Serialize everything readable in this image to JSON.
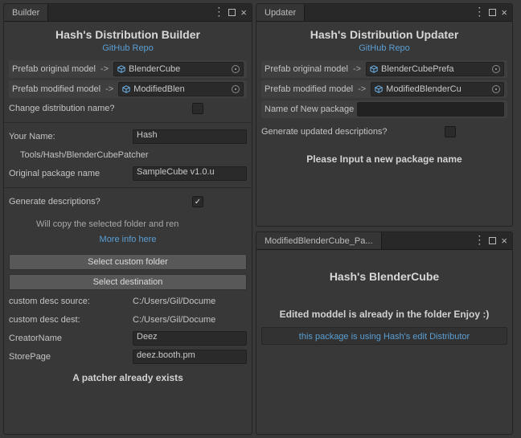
{
  "builder": {
    "tab": "Builder",
    "title": "Hash's Distribution Builder",
    "repo_link": "GitHub Repo",
    "prefab_orig_label": "Prefab original model",
    "prefab_orig_value": "BlenderCube",
    "prefab_mod_label": "Prefab modified model",
    "prefab_mod_value": "ModifiedBlen",
    "change_name_label": "Change distribution name?",
    "your_name_label": "Your Name:",
    "your_name_value": "Hash",
    "tools_path": "Tools/Hash/BlenderCubePatcher",
    "orig_pkg_label": "Original package name",
    "orig_pkg_value": "SampleCube v1.0.u",
    "gen_desc_label": "Generate descriptions?",
    "gen_desc_checked": "✓",
    "copy_note": "Will copy the selected folder and ren",
    "more_info": "More info here",
    "select_folder_btn": "Select custom folder",
    "select_dest_btn": "Select destination",
    "desc_src_label": "custom desc source:",
    "desc_src_value": "C:/Users/Gil/Docume",
    "desc_dst_label": "custom desc dest:",
    "desc_dst_value": "C:/Users/Gil/Docume",
    "creator_label": "CreatorName",
    "creator_value": "Deez",
    "store_label": "StorePage",
    "store_value": "deez.booth.pm",
    "footer": "A patcher already exists"
  },
  "updater": {
    "tab": "Updater",
    "title": "Hash's Distribution Updater",
    "repo_link": "GitHub Repo",
    "prefab_orig_label": "Prefab original model",
    "prefab_orig_value": "BlenderCubePrefa",
    "prefab_mod_label": "Prefab modified model",
    "prefab_mod_value": "ModifiedBlenderCu",
    "new_pkg_label": "Name of New package",
    "gen_upd_label": "Generate updated descriptions?",
    "footer": "Please Input a new package name"
  },
  "inspector": {
    "tab": "ModifiedBlenderCube_Pa...",
    "title": "Hash's BlenderCube",
    "status": "Edited moddel is already in the folder Enjoy :)",
    "credit": "this package is using Hash's edit Distributor"
  }
}
